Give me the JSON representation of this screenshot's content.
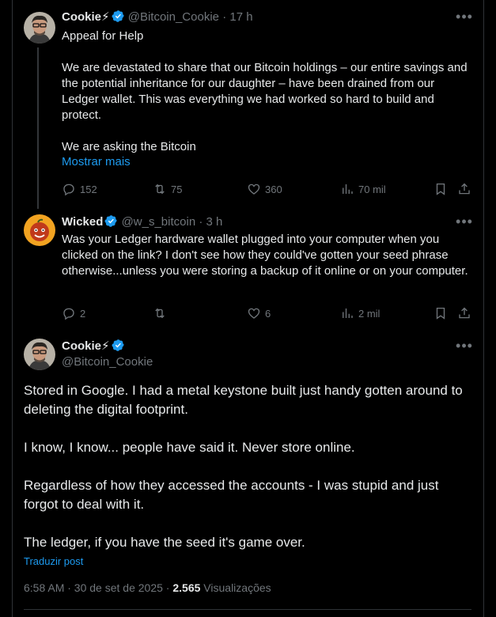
{
  "tweets": [
    {
      "name": "Cookie⚡",
      "handle": "@Bitcoin_Cookie",
      "time": "· 17 h",
      "title": "Appeal for Help",
      "body": "We are devastated to share that our Bitcoin holdings – our entire savings and the potential inheritance for our daughter – have been drained from our Ledger wallet. This was everything we had worked so hard to build and protect.\n\nWe are asking the Bitcoin",
      "show_more": "Mostrar mais",
      "replies": "152",
      "retweets": "75",
      "likes": "360",
      "views": "70 mil"
    },
    {
      "name": "Wicked",
      "handle": "@w_s_bitcoin",
      "time": "· 3 h",
      "body": "Was your Ledger hardware wallet plugged into your computer when you clicked on the link? I don't see how they could've gotten your seed phrase otherwise...unless you were storing a backup of it online or on your computer.",
      "replies": "2",
      "retweets": "",
      "likes": "6",
      "views": "2 mil"
    }
  ],
  "main": {
    "name": "Cookie⚡",
    "handle": "@Bitcoin_Cookie",
    "body": "Stored in Google. I had a metal keystone built just handy gotten around to deleting the digital footprint.\n\nI know, I know... people have said it. Never store online.\n\nRegardless of how they accessed the accounts - I was stupid and just forgot to deal with it.\n\nThe ledger, if you have the seed it's game over.",
    "translate": "Traduzir post",
    "timestamp": "6:58 AM · 30 de set de 2025 ·",
    "views_count": "2.565",
    "views_label": "Visualizações"
  },
  "colors": {
    "accent": "#1d9bf0",
    "muted": "#71767b",
    "text": "#e7e9ea",
    "background": "#000000"
  }
}
